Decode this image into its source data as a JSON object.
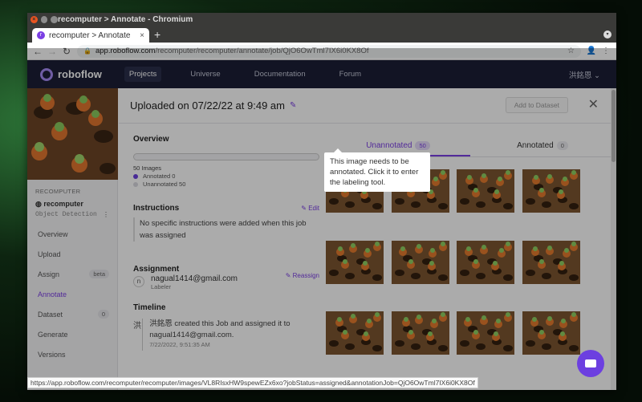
{
  "browser": {
    "window_title": "recomputer > Annotate - Chromium",
    "tab_title": "recomputer > Annotate",
    "url_domain": "app.roboflow.com",
    "url_path": "/recomputer/recomputer/annotate/job/QjO6OwTml7IX6i0KX8Of",
    "status_url": "https://app.roboflow.com/recomputer/recomputer/images/VL8RIsxHW9spewEZx6xo?jobStatus=assigned&annotationJob=QjO6OwTml7IX6i0KX8Of"
  },
  "nav": {
    "brand": "roboflow",
    "links": [
      "Projects",
      "Universe",
      "Documentation",
      "Forum"
    ],
    "active": "Projects",
    "user": "洪銘恩"
  },
  "sidebar": {
    "workspace_label": "RECOMPUTER",
    "project_name": "recomputer",
    "project_type": "Object Detection",
    "items": [
      {
        "label": "Overview"
      },
      {
        "label": "Upload"
      },
      {
        "label": "Assign",
        "badge": "beta"
      },
      {
        "label": "Annotate",
        "active": true
      },
      {
        "label": "Dataset",
        "badge": "0"
      },
      {
        "label": "Generate"
      },
      {
        "label": "Versions"
      }
    ]
  },
  "job": {
    "title": "Uploaded on 07/22/22 at 9:49 am",
    "add_to_dataset": "Add to Dataset",
    "overview_title": "Overview",
    "images_count": "50 Images",
    "annotated_label": "Annotated 0",
    "unannotated_label": "Unannotated 50",
    "progress_fraction": 0.0,
    "instructions_title": "Instructions",
    "edit_label": "Edit",
    "instructions_text": "No specific instructions were added when this job was assigned",
    "assignment_title": "Assignment",
    "reassign_label": "Reassign",
    "assignee_initial": "n",
    "assignee_email": "nagual1414@gmail.com",
    "assignee_role": "Labeler",
    "timeline_title": "Timeline",
    "timeline_initial": "洪",
    "timeline_text": "洪銘恩 created this Job and assigned it to nagual1414@gmail.com.",
    "timeline_time": "7/22/2022, 9:51:35 AM"
  },
  "image_tabs": [
    {
      "label": "Unannotated",
      "count": "50",
      "active": true
    },
    {
      "label": "Annotated",
      "count": "0",
      "active": false
    }
  ],
  "tooltip": "This image needs to be annotated. Click it to enter the labeling tool.",
  "colors": {
    "accent": "#7b3fe4",
    "nav_bg": "#1b1f36",
    "annotated_dot": "#6c3fe0",
    "unannotated_dot": "#d8d8e0"
  }
}
